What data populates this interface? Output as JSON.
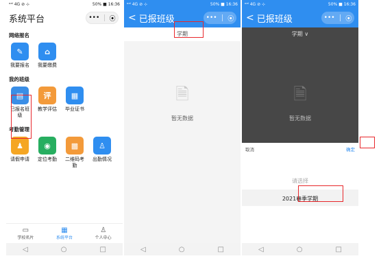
{
  "status": {
    "left": "ᵒᵃˡ 4G ⊘ ⊹",
    "right": "50% ■ 16:36"
  },
  "phone1": {
    "title": "系统平台",
    "capsule": {
      "dots": "•••",
      "target": "⦿"
    },
    "sections": [
      {
        "title": "网络报名",
        "items": [
          {
            "label": "我要报名",
            "color": "#2f8ef0",
            "glyph": "✎"
          },
          {
            "label": "我要缴费",
            "color": "#2f8ef0",
            "glyph": "⌂"
          }
        ]
      },
      {
        "title": "我的班级",
        "items": [
          {
            "label": "已报名班级",
            "color": "#3a8ee6",
            "glyph": "▤"
          },
          {
            "label": "教学评估",
            "color": "#f39a3a",
            "glyph": "评"
          },
          {
            "label": "毕业证书",
            "color": "#2f8ef0",
            "glyph": "▦"
          }
        ]
      },
      {
        "title": "考勤管理",
        "items": [
          {
            "label": "请假申请",
            "color": "#f5a623",
            "glyph": "♟"
          },
          {
            "label": "定位考勤",
            "color": "#27ae60",
            "glyph": "◉"
          },
          {
            "label": "二维码考勤",
            "color": "#f39a3a",
            "glyph": "▩"
          },
          {
            "label": "出勤情况",
            "color": "#2f8ef0",
            "glyph": "♙"
          }
        ]
      }
    ],
    "tabs": [
      {
        "label": "学校名片",
        "glyph": "▭"
      },
      {
        "label": "系统平台",
        "glyph": "▦"
      },
      {
        "label": "个人中心",
        "glyph": "♙"
      }
    ]
  },
  "phone2": {
    "back": "<",
    "title": "已报班级",
    "filter": "学期",
    "empty_text": "暂无数据"
  },
  "phone3": {
    "back": "<",
    "title": "已报班级",
    "filter": "学期 ∨",
    "empty_text": "暂无数据",
    "cancel": "取消",
    "confirm": "确定",
    "placeholder": "请选择",
    "option": "2021春季学期"
  },
  "sysnav": {
    "back": "◁",
    "home": "○",
    "recent": "□"
  },
  "colors": {
    "brand_blue": "#2f8ef0",
    "highlight_red": "#e8262a"
  }
}
